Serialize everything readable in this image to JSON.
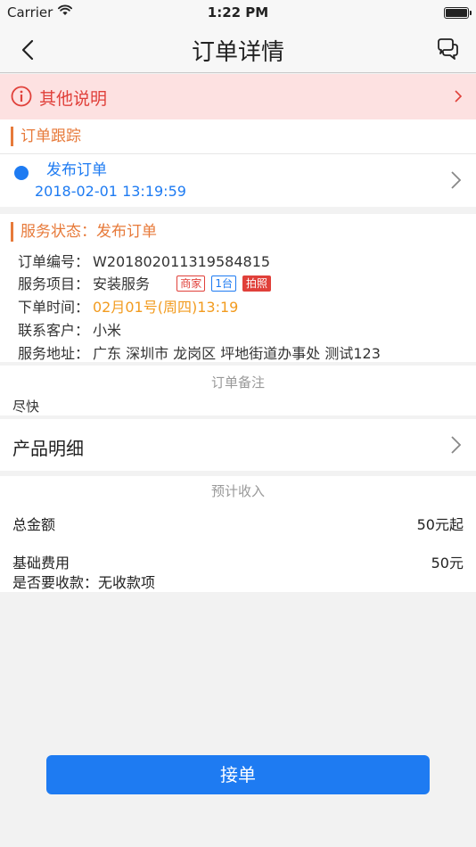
{
  "status_bar": {
    "carrier": "Carrier",
    "time": "1:22 PM"
  },
  "nav": {
    "title": "订单详情",
    "back_icon": "chevron-left-icon",
    "chat_icon": "chat-bubbles-icon"
  },
  "notice": {
    "text": "其他说明",
    "icon": "info-circle-icon",
    "color": "#e0403a",
    "background": "#fde1e1"
  },
  "tracking": {
    "title": "订单跟踪",
    "entries": [
      {
        "label": "发布订单",
        "time": "2018-02-01 13:19:59"
      }
    ]
  },
  "service": {
    "status_label": "服务状态：",
    "status_value": "发布订单",
    "order_no_label": "订单编号：",
    "order_no": "W201802011319584815",
    "item_label": "服务项目：",
    "item": "安装服务",
    "tags": [
      "商家",
      "1台",
      "拍照"
    ],
    "time_label": "下单时间：",
    "time": "02月01号(周四)13:19",
    "customer_label": "联系客户：",
    "customer": "小米",
    "address_label": "服务地址：",
    "address": "广东 深圳市 龙岗区 坪地街道办事处 测试123"
  },
  "remark": {
    "heading": "订单备注",
    "text": "尽快"
  },
  "product": {
    "label": "产品明细"
  },
  "income": {
    "heading": "预计收入",
    "total_label": "总金额",
    "total_value": "50元起",
    "base_label": "基础费用",
    "base_value": "50元",
    "collect_text": "是否要收款：无收款项"
  },
  "actions": {
    "accept_label": "接单"
  },
  "colors": {
    "accent_blue": "#1e7bf2",
    "accent_orange": "#e77a3a",
    "time_orange": "#f29b1f"
  }
}
